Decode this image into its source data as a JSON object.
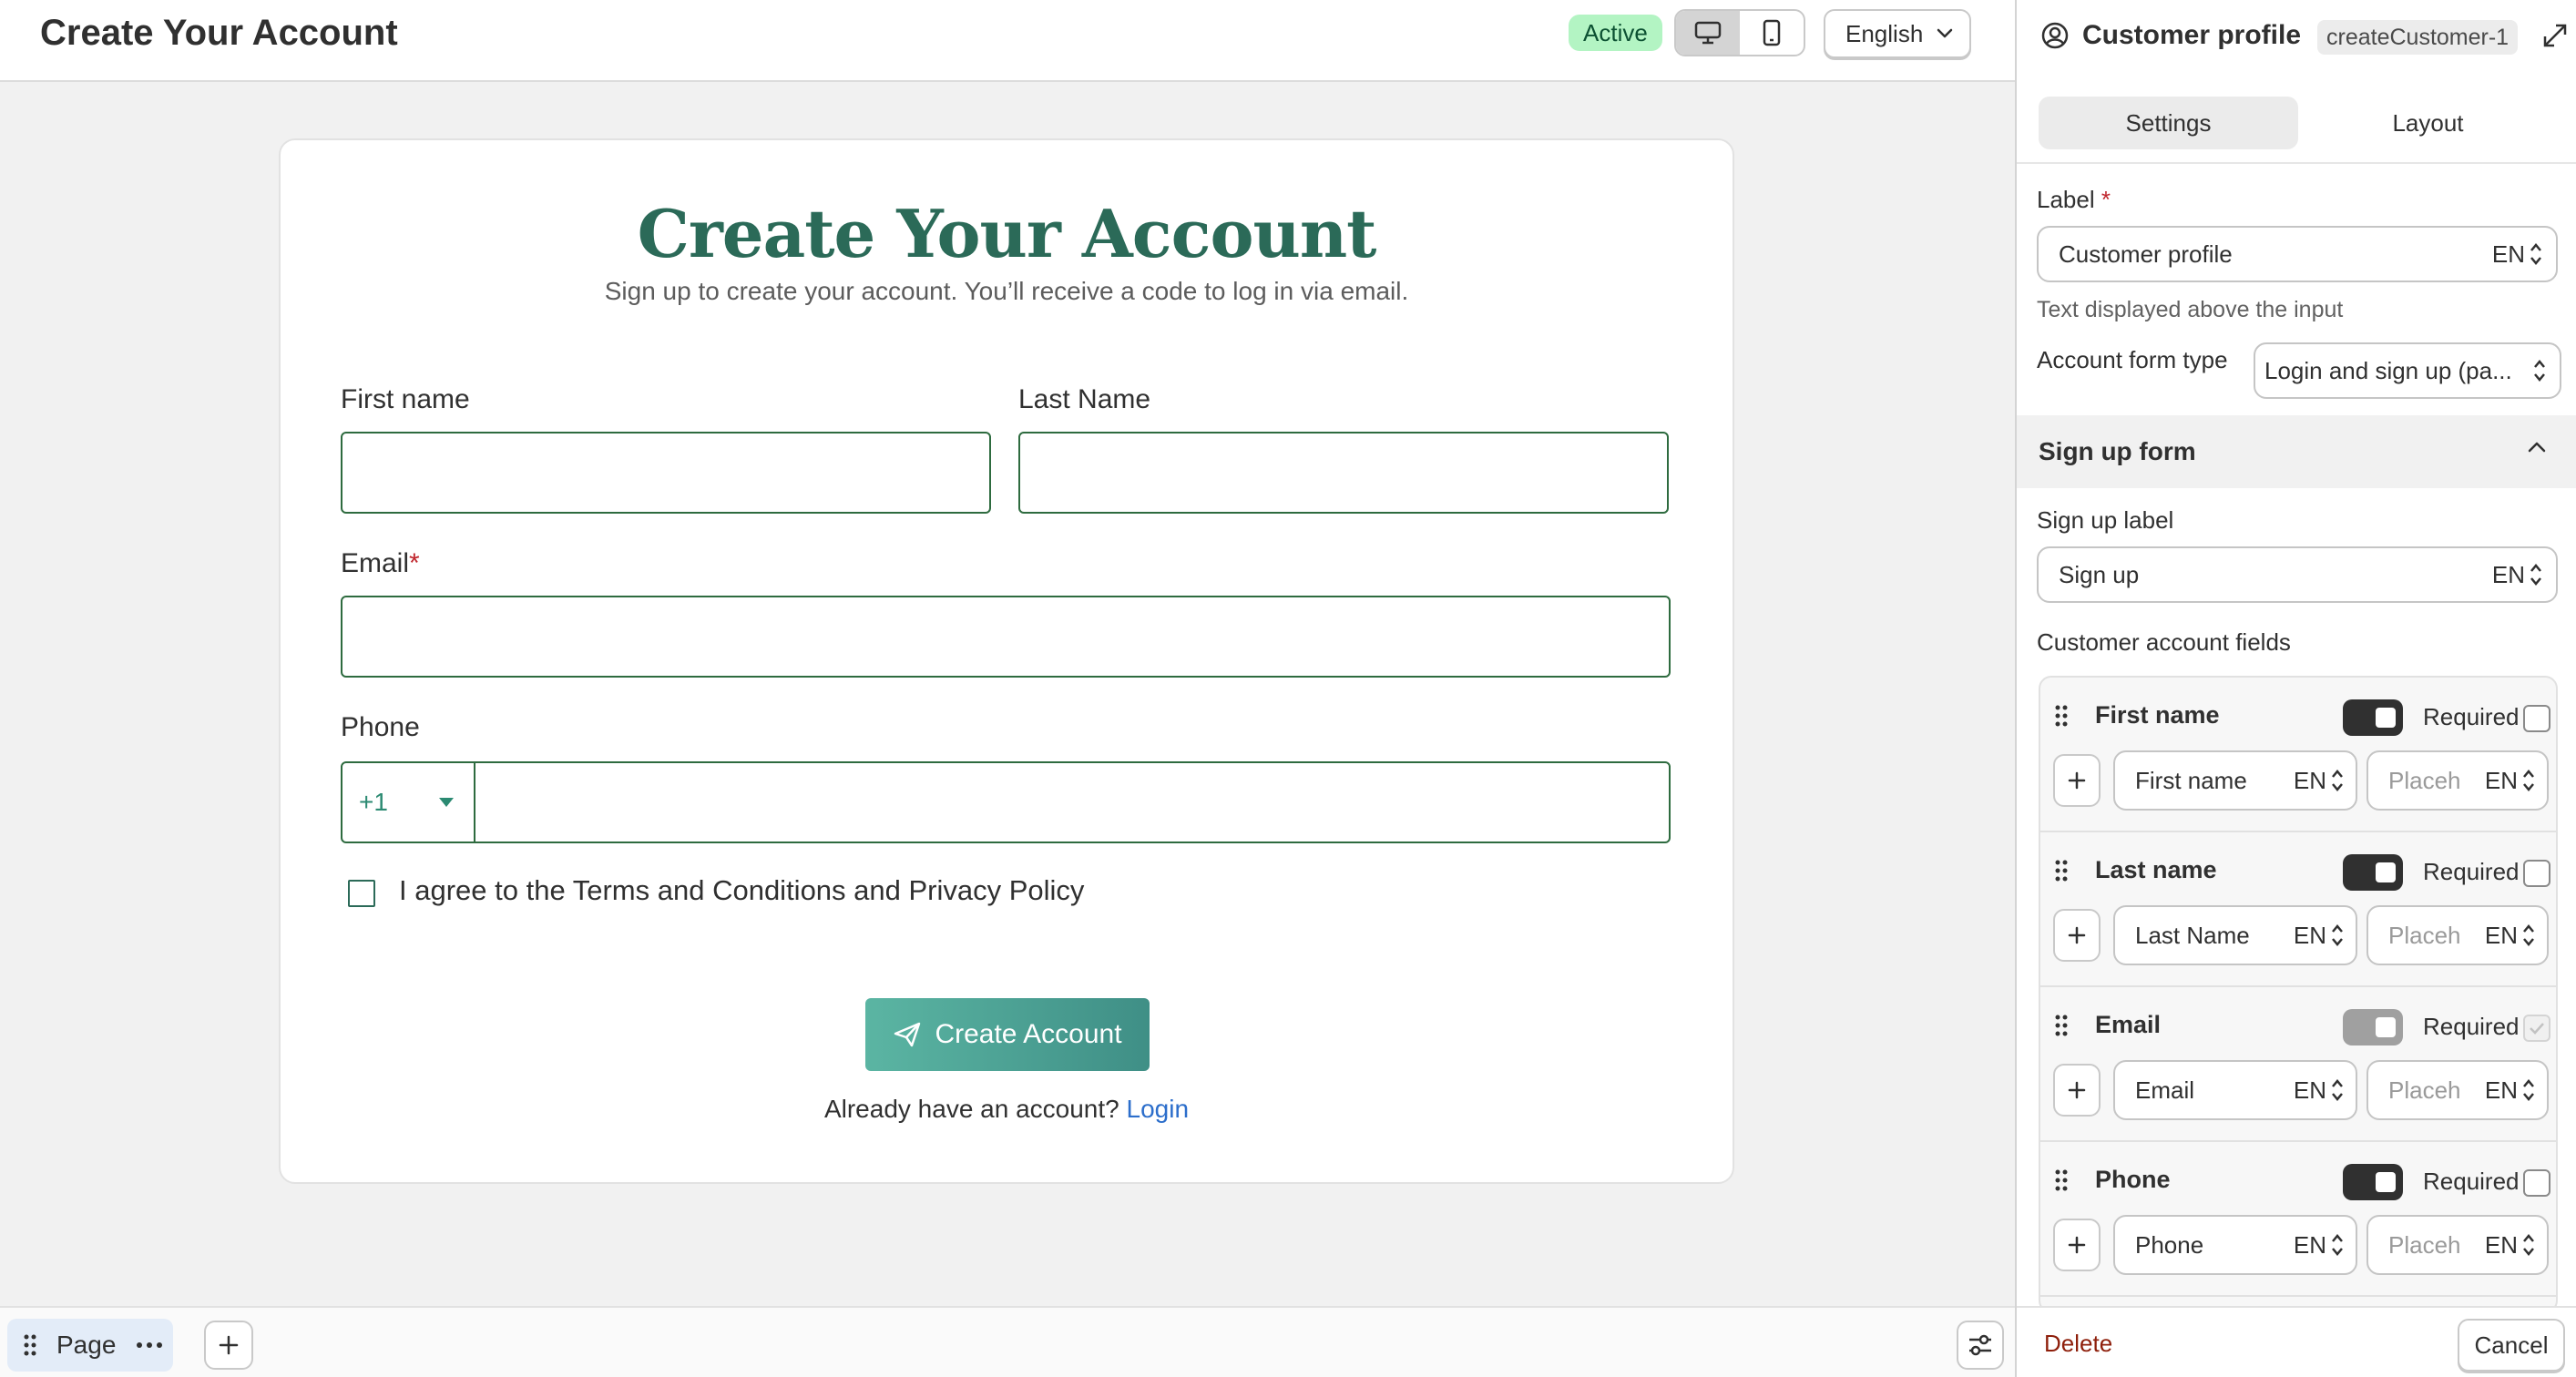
{
  "topbar": {
    "title": "Create Your Account",
    "status_badge": "Active",
    "language": "English"
  },
  "form": {
    "heading": "Create Your Account",
    "subheading": "Sign up to create your account. You’ll receive a code to log in via email.",
    "first_name_label": "First name",
    "last_name_label": "Last Name",
    "email_label": "Email",
    "required_mark": "*",
    "phone_label": "Phone",
    "phone_code": "+1",
    "agree_text": "I agree to the Terms and Conditions and Privacy Policy",
    "submit_label": "Create Account",
    "already_text": "Already have an account?",
    "login_link": "Login"
  },
  "bottombar": {
    "page_label": "Page"
  },
  "panel": {
    "title": "Customer profile",
    "block_id": "createCustomer-1",
    "tabs": [
      "Settings",
      "Layout"
    ],
    "active_tab": "Settings",
    "label_title": "Label",
    "required_mark": "*",
    "label_value": "Customer profile",
    "lang_code": "EN",
    "label_help": "Text displayed above the input",
    "form_type_label": "Account form type",
    "form_type_value": "Login and sign up (pa...",
    "section_title": "Sign up form",
    "signup_label_title": "Sign up label",
    "signup_label_value": "Sign up",
    "fields_title": "Customer account fields",
    "required_text": "Required",
    "placeholder_text": "Placeh",
    "fields": [
      {
        "name": "First name",
        "label": "First name",
        "toggle_on": true,
        "toggle_disabled": false,
        "required": false
      },
      {
        "name": "Last name",
        "label": "Last Name",
        "toggle_on": true,
        "toggle_disabled": false,
        "required": false
      },
      {
        "name": "Email",
        "label": "Email",
        "toggle_on": true,
        "toggle_disabled": true,
        "required": true
      },
      {
        "name": "Phone",
        "label": "Phone",
        "toggle_on": true,
        "toggle_disabled": false,
        "required": false
      }
    ],
    "delete_label": "Delete",
    "cancel_label": "Cancel"
  },
  "colors": {
    "brand_green": "#2b6a58",
    "button_gradient_start": "#5bb5a3",
    "button_gradient_end": "#3f8f86",
    "link_blue": "#2c6ecb",
    "badge_bg": "#b3f4c3",
    "delete_red": "#8e1f0b"
  },
  "icons": {
    "desktop": "desktop-icon",
    "mobile": "mobile-icon",
    "chevron": "chevron-down-icon",
    "profile": "profile-icon",
    "expand": "expand-icon",
    "drag": "drag-handle-icon",
    "more": "more-horizontal-icon",
    "plus": "plus-icon",
    "tune": "settings-sliders-icon",
    "send": "paper-plane-icon",
    "selector": "selector-icon"
  }
}
